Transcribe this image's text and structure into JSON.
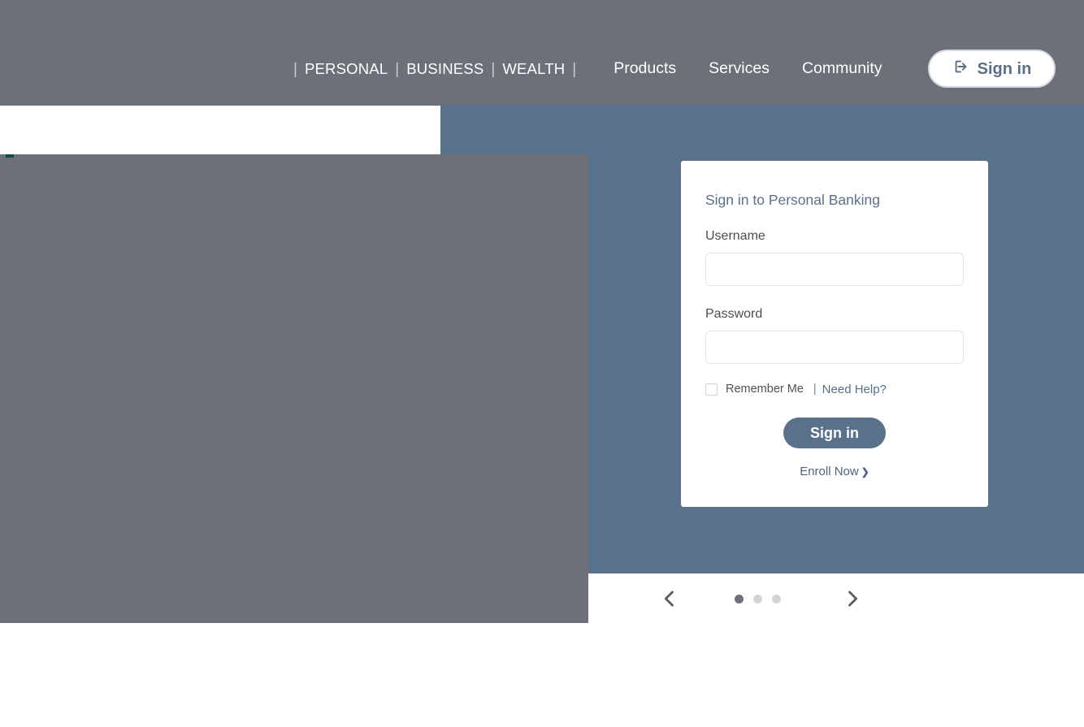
{
  "header": {
    "background_color": "#6d7078",
    "nav": {
      "separator": "|",
      "caps_items": [
        {
          "label": "PERSONAL",
          "name": "nav-personal"
        },
        {
          "label": "BUSINESS",
          "name": "nav-business"
        },
        {
          "label": "WEALTH",
          "name": "nav-wealth"
        }
      ],
      "plain_items": [
        {
          "label": "Products",
          "name": "nav-products"
        },
        {
          "label": "Services",
          "name": "nav-services"
        },
        {
          "label": "Community",
          "name": "nav-community"
        }
      ]
    },
    "signin_button": {
      "label": "Sign in",
      "icon": "login-icon",
      "text_color": "#5a7089",
      "background_color": "#ffffff"
    }
  },
  "hero": {
    "background_color": "#5a718c"
  },
  "login_card": {
    "title": "Sign in to Personal Banking",
    "title_color": "#5b7089",
    "username": {
      "label": "Username",
      "value": "",
      "placeholder": ""
    },
    "password": {
      "label": "Password",
      "value": "",
      "placeholder": ""
    },
    "remember": {
      "label": "Remember Me",
      "checked": false,
      "separator": "|",
      "help_link": "Need Help?"
    },
    "submit_label": "Sign in",
    "submit_color": "#5a718c",
    "enroll_link": "Enroll Now",
    "enroll_chevron": "❯"
  },
  "carousel": {
    "prev_icon": "chevron-left-icon",
    "next_icon": "chevron-right-icon",
    "total_slides": 3,
    "active_slide": 1,
    "active_dot_color": "#6d7078",
    "inactive_dot_color": "#d2d4d7"
  }
}
